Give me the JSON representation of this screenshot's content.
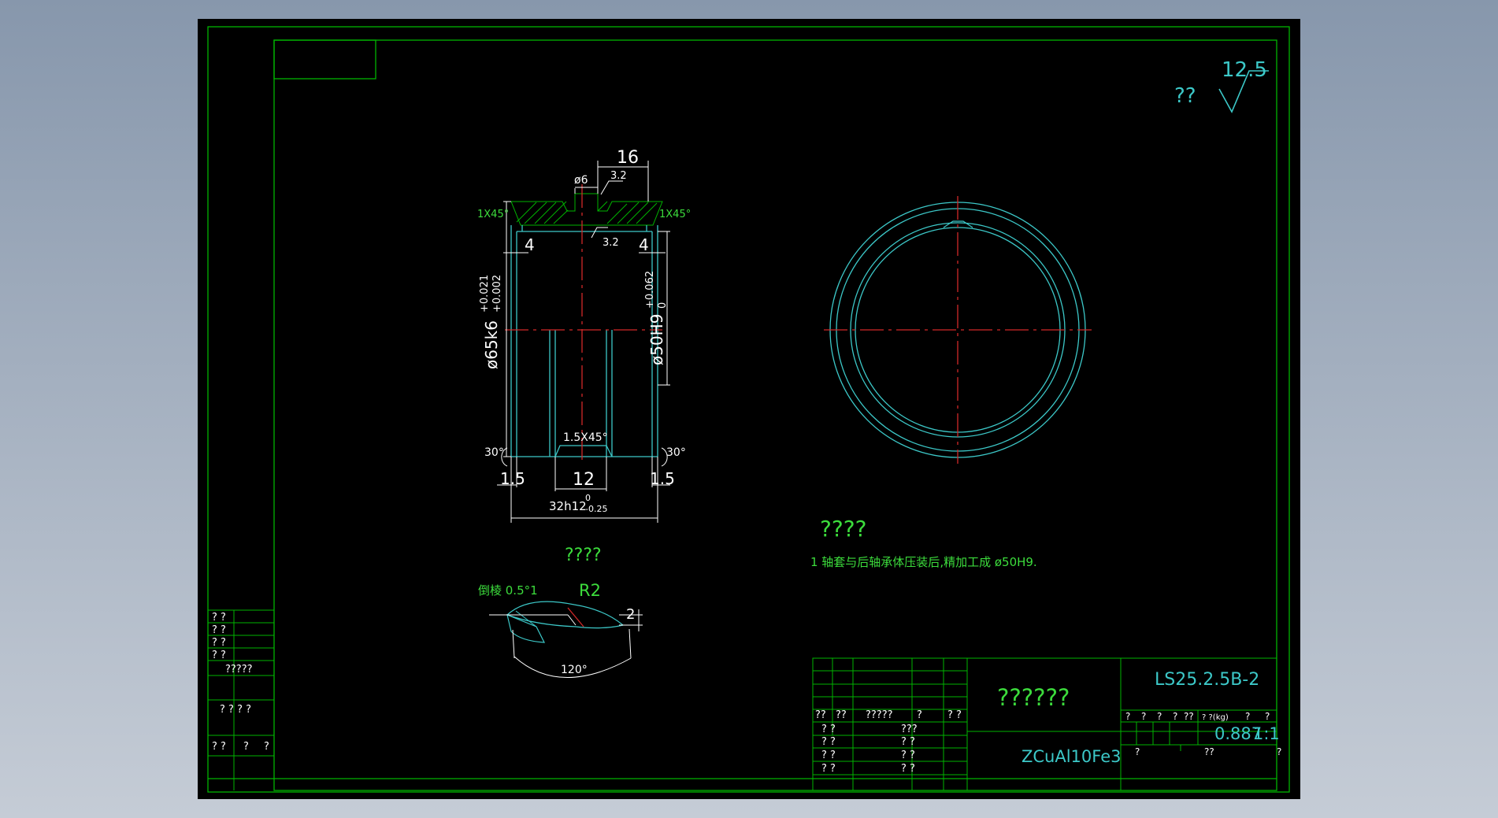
{
  "colors": {
    "background_outer": "#8797ac",
    "canvas": "#000000",
    "border": "#00b400",
    "outline": "#3cc8c8",
    "hatch": "#00b400",
    "centerline": "#d22828",
    "dimension": "#ffffff",
    "text_green": "#3cdc3c",
    "text_cyan": "#3cc8c8"
  },
  "roughness": {
    "label": "??",
    "value": "12.5"
  },
  "section_view": {
    "dims": {
      "top_width": "16",
      "hole_dia": "ø6",
      "roughness_top": "3.2",
      "roughness_bore": "3.2",
      "chamfer_left": "1X45°",
      "chamfer_right": "1X45°",
      "inner_left": "4",
      "inner_right": "4",
      "outer_dia": "ø65k6",
      "outer_tol_upper": "+0.021",
      "outer_tol_lower": "+0.002",
      "bore_dia": "ø50H9",
      "bore_tol_upper": "+0.062",
      "bore_tol_lower": "0",
      "angle_left": "30°",
      "angle_right": "30°",
      "groove_chamfer": "1.5X45°",
      "bottom_left": "1.5",
      "bottom_mid": "12",
      "bottom_right": "1.5",
      "length": "32h12",
      "length_tol_upper": "0",
      "length_tol_lower": "-0.25"
    }
  },
  "detail_view": {
    "title": "????",
    "chamfer": "倒棱 0.5°1",
    "radius": "R2",
    "depth": "2",
    "angle": "120°"
  },
  "notes": {
    "title": "????",
    "line1": "1 轴套与后轴承体压装后,精加工成 ø50H9."
  },
  "left_table": {
    "rows_a": [
      "? ?",
      "? ?",
      "? ?",
      "? ?"
    ],
    "row_b": "?????",
    "row_c": "? ? ? ?",
    "row_d": [
      "? ?",
      "?",
      "?"
    ]
  },
  "title_block": {
    "part_name": "??????",
    "drawing_no": "LS25.2.5B-2",
    "material": "ZCuAl10Fe3",
    "headers_left": [
      "??",
      "??",
      "?????",
      "?",
      "? ?"
    ],
    "sign_rows": [
      [
        "?  ?",
        "???"
      ],
      [
        "?  ?",
        "?  ?"
      ],
      [
        "?  ?",
        "?  ?"
      ],
      [
        "?  ?",
        "?  ?"
      ]
    ],
    "stage_headers": [
      "?",
      "?",
      "?",
      "?",
      "??",
      "? ?(kg)",
      "?",
      "?"
    ],
    "weight": "0.887",
    "scale": "1:1",
    "footer_left": "?",
    "footer_mid": "??",
    "footer_right": "?"
  }
}
